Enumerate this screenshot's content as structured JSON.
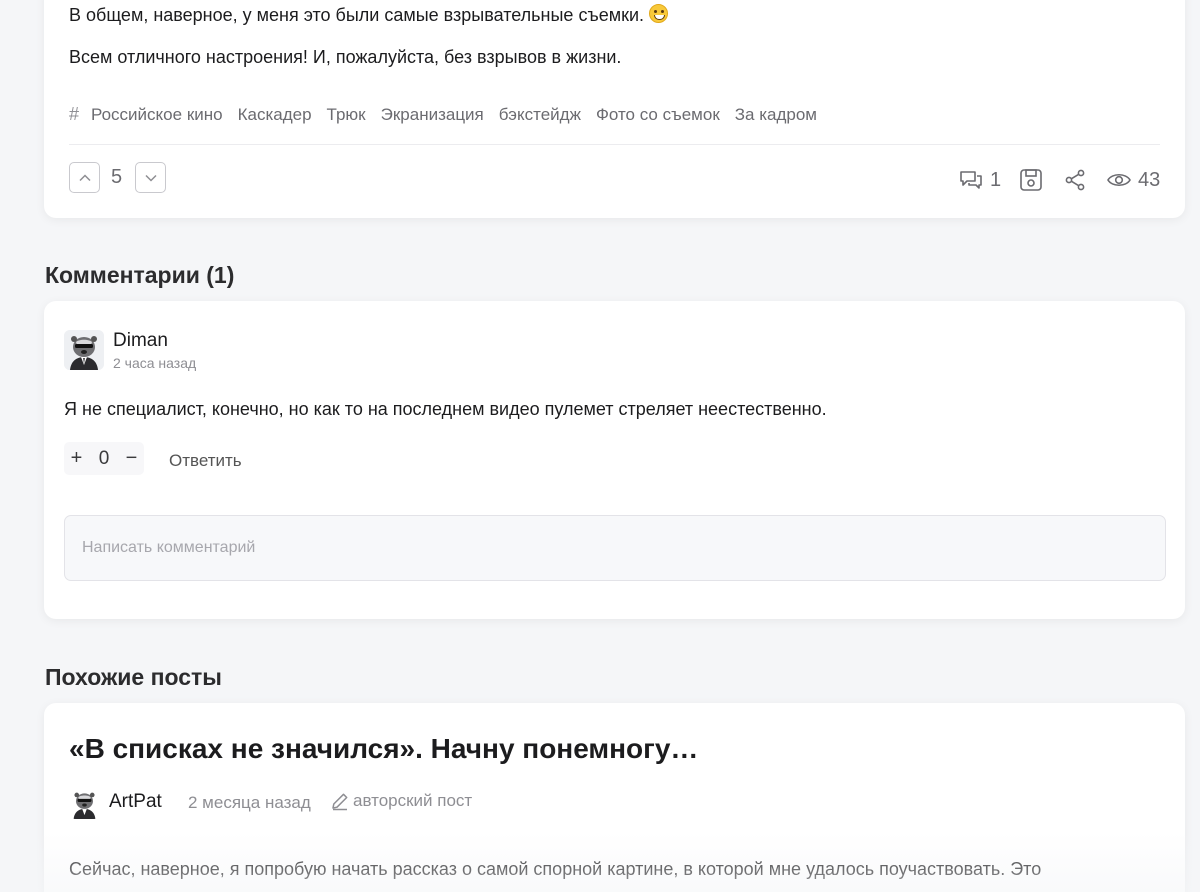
{
  "post": {
    "paragraphs": [
      "В общем, наверное, у меня это были самые взрывательные съемки.",
      "Всем отличного настроения! И, пожалуйста, без взрывов в жизни."
    ],
    "emoji_icon": "grinning-face-emoji",
    "tags_icon": "#",
    "tags": [
      "Российское кино",
      "Каскадер",
      "Трюк",
      "Экранизация",
      "бэкстейдж",
      "Фото со съемок",
      "За кадром"
    ],
    "rating": "5",
    "comments_count": "1",
    "views_count": "43",
    "icons": [
      "chevron-up-icon",
      "chevron-down-icon",
      "comments-icon",
      "save-icon",
      "share-icon",
      "eye-icon"
    ]
  },
  "comments": {
    "title": "Комментарии (1)",
    "items": [
      {
        "author": "Diman",
        "time": "2 часа назад",
        "text": "Я не специалист, конечно, но как то на последнем видео пулемет стреляет неестественно.",
        "plus": "+",
        "rating": "0",
        "minus": "−",
        "reply_label": "Ответить"
      }
    ],
    "input_placeholder": "Написать комментарий"
  },
  "similar": {
    "title": "Похожие посты",
    "posts": [
      {
        "title": "«В списках не значился». Начну понемногу…",
        "author": "ArtPat",
        "time": "2 месяца назад",
        "badge": "авторский пост",
        "excerpt": "Сейчас, наверное, я попробую начать рассказ о самой спорной картине, в которой мне удалось поучаствовать. Это"
      }
    ]
  },
  "colors": {
    "background": "#f5f6f8",
    "card": "#ffffff",
    "muted_text": "#8e8e93",
    "primary_text": "#1c1c1e"
  }
}
